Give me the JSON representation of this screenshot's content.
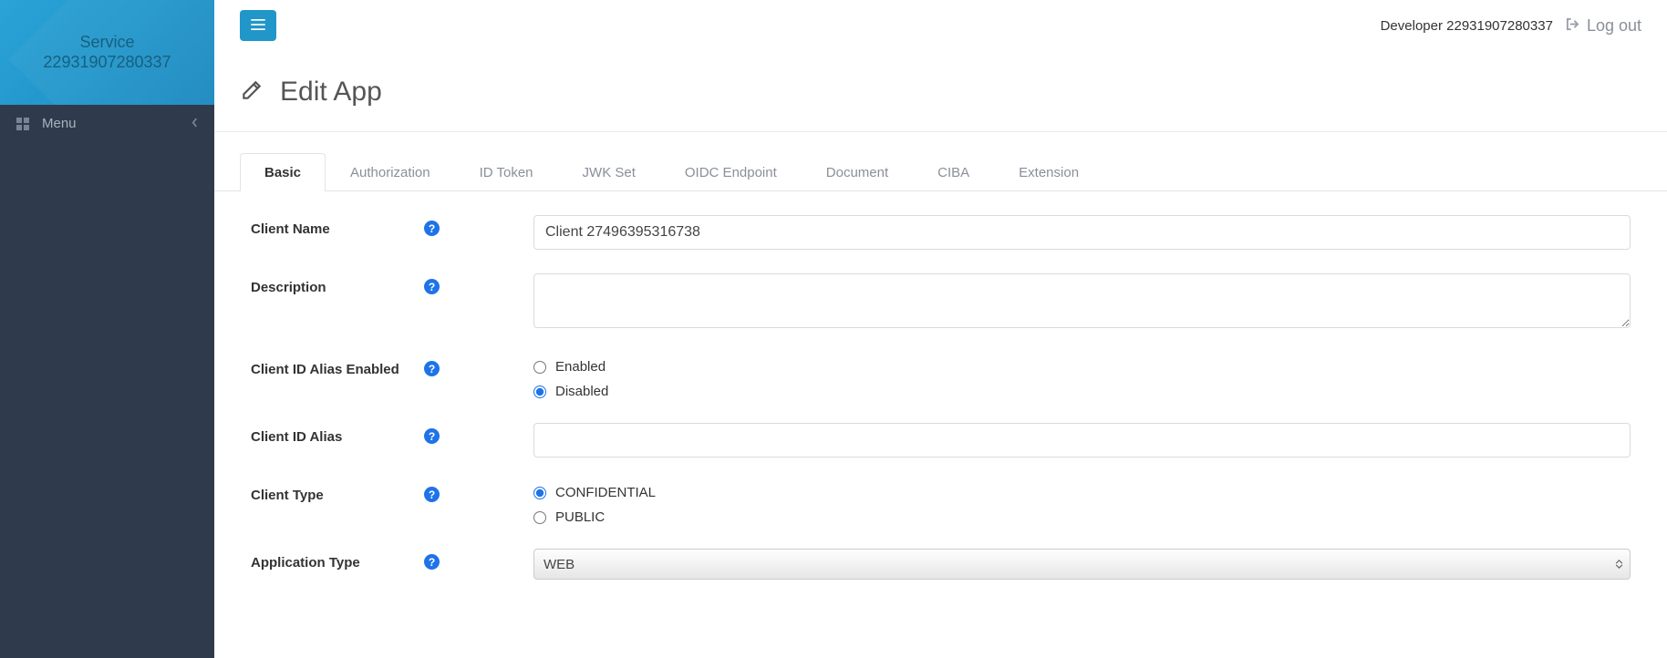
{
  "sidebar": {
    "brand_line1": "Service",
    "brand_line2": "22931907280337",
    "menu_label": "Menu"
  },
  "topbar": {
    "user_label": "Developer 22931907280337",
    "logout_label": "Log out"
  },
  "page": {
    "title": "Edit App"
  },
  "tabs": [
    {
      "label": "Basic",
      "active": true
    },
    {
      "label": "Authorization",
      "active": false
    },
    {
      "label": "ID Token",
      "active": false
    },
    {
      "label": "JWK Set",
      "active": false
    },
    {
      "label": "OIDC Endpoint",
      "active": false
    },
    {
      "label": "Document",
      "active": false
    },
    {
      "label": "CIBA",
      "active": false
    },
    {
      "label": "Extension",
      "active": false
    }
  ],
  "form": {
    "client_name": {
      "label": "Client Name",
      "value": "Client 27496395316738"
    },
    "description": {
      "label": "Description",
      "value": ""
    },
    "client_id_alias_enabled": {
      "label": "Client ID Alias Enabled",
      "options": {
        "enabled": "Enabled",
        "disabled": "Disabled"
      },
      "selected": "disabled"
    },
    "client_id_alias": {
      "label": "Client ID Alias",
      "value": ""
    },
    "client_type": {
      "label": "Client Type",
      "options": {
        "confidential": "CONFIDENTIAL",
        "public": "PUBLIC"
      },
      "selected": "confidential"
    },
    "application_type": {
      "label": "Application Type",
      "selected": "WEB"
    }
  }
}
